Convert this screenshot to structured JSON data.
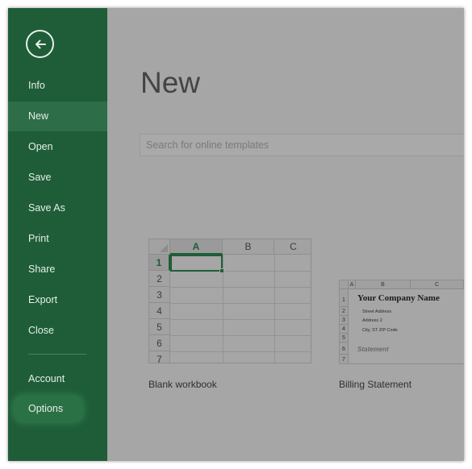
{
  "sidebar": {
    "back_label": "Back",
    "items": [
      {
        "label": "Info"
      },
      {
        "label": "New"
      },
      {
        "label": "Open"
      },
      {
        "label": "Save"
      },
      {
        "label": "Save As"
      },
      {
        "label": "Print"
      },
      {
        "label": "Share"
      },
      {
        "label": "Export"
      },
      {
        "label": "Close"
      },
      {
        "label": "Account"
      },
      {
        "label": "Options"
      }
    ],
    "active_item": "New"
  },
  "main": {
    "title": "New",
    "search": {
      "placeholder": "Search for online templates",
      "value": ""
    },
    "templates": [
      {
        "label": "Blank workbook",
        "columns": [
          "A",
          "B",
          "C"
        ],
        "rows": [
          "1",
          "2",
          "3",
          "4",
          "5",
          "6",
          "7"
        ]
      },
      {
        "label": "Billing Statement",
        "columns": [
          "A",
          "B",
          "C"
        ],
        "rows": [
          "1",
          "2",
          "3",
          "4",
          "5",
          "6",
          "7"
        ],
        "company": "Your Company Name",
        "address_lines": [
          "Street Address",
          "Address 2",
          "City, ST  ZIP Code"
        ],
        "heading": "Statement"
      }
    ]
  },
  "colors": {
    "sidebar": "#1e5d38",
    "sidebar_active": "#2d6e48",
    "main_background": "#a6a6a6",
    "accent": "#1e5d38"
  },
  "icons": {
    "back": "arrow-left-circle-icon"
  }
}
